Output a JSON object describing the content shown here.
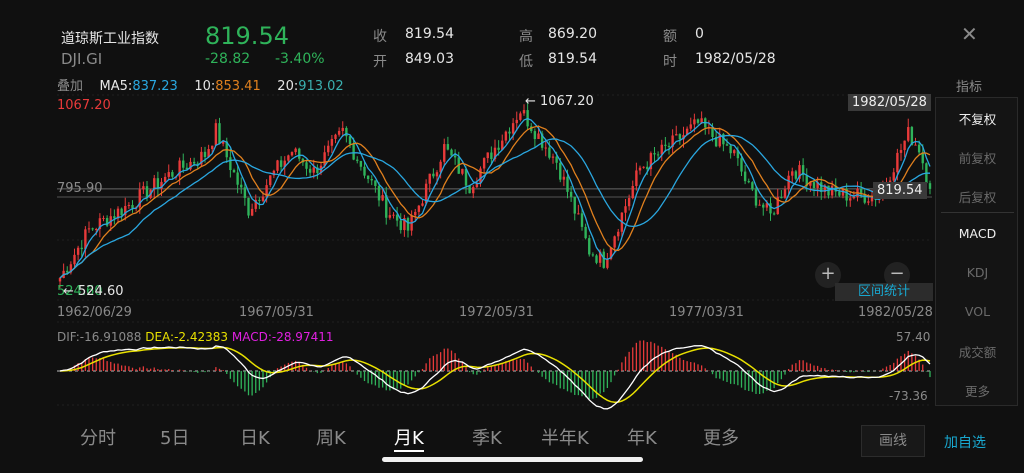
{
  "header": {
    "name": "道琼斯工业指数",
    "code": "DJI.GI",
    "price": "819.54",
    "change": "-28.82",
    "change_pct": "-3.40%",
    "close_label": "收",
    "close": "819.54",
    "open_label": "开",
    "open": "849.03",
    "high_label": "高",
    "high": "869.20",
    "low_label": "低",
    "low": "819.54",
    "amount_label": "额",
    "amount": "0",
    "time_label": "时",
    "time": "1982/05/28"
  },
  "overlay": {
    "label": "叠加",
    "ma5_label": "MA5:",
    "ma5": "837.23",
    "ma10_label": "10:",
    "ma10": "853.41",
    "ma20_label": "20:",
    "ma20": "913.02"
  },
  "colors": {
    "up": "#e83a3a",
    "down": "#2fb35a",
    "ma5": "#2aa7e0",
    "ma10": "#e0801e",
    "ma20": "#2aa7e0",
    "dif": "#ffffff",
    "dea": "#e8e000",
    "macd": "#e020e0"
  },
  "chart": {
    "max_label": "1067.20",
    "max_marker": "1067.20",
    "mid_label": "795.90",
    "min_label": "524.60",
    "min_marker": "524.60",
    "cursor_date": "1982/05/28",
    "cursor_price": "819.54",
    "dates": [
      "1962/06/29",
      "1967/05/31",
      "1972/05/31",
      "1977/03/31",
      "1982/05/28"
    ],
    "zoom_in": "+",
    "zoom_out": "−",
    "range_stats": "区间统计"
  },
  "macd": {
    "dif": "DIF:-16.91088",
    "dea": "DEA:-2.42383",
    "macd": "MACD:-28.97411",
    "max": "57.40",
    "min": "-73.36"
  },
  "chart_data": {
    "type": "candlestick",
    "x_start": "1962/06",
    "x_end": "1982/05",
    "ylim": [
      524.6,
      1067.2
    ],
    "anchors": [
      [
        0,
        560
      ],
      [
        8,
        700
      ],
      [
        20,
        780
      ],
      [
        30,
        860
      ],
      [
        40,
        920
      ],
      [
        43,
        990
      ],
      [
        52,
        760
      ],
      [
        60,
        880
      ],
      [
        64,
        930
      ],
      [
        70,
        870
      ],
      [
        78,
        985
      ],
      [
        90,
        760
      ],
      [
        96,
        700
      ],
      [
        106,
        940
      ],
      [
        113,
        830
      ],
      [
        127,
        1050
      ],
      [
        137,
        900
      ],
      [
        146,
        640
      ],
      [
        150,
        610
      ],
      [
        160,
        880
      ],
      [
        170,
        960
      ],
      [
        176,
        1010
      ],
      [
        186,
        920
      ],
      [
        190,
        820
      ],
      [
        196,
        740
      ],
      [
        202,
        880
      ],
      [
        212,
        810
      ],
      [
        218,
        800
      ],
      [
        226,
        800
      ],
      [
        234,
        980
      ],
      [
        237,
        940
      ],
      [
        240,
        819.54
      ]
    ]
  },
  "side": {
    "title": "指标",
    "items": [
      "不复权",
      "前复权",
      "后复权",
      "MACD",
      "KDJ",
      "VOL",
      "成交额",
      "更多"
    ]
  },
  "tabs": [
    "分时",
    "5日",
    "日K",
    "周K",
    "月K",
    "季K",
    "半年K",
    "年K",
    "更多"
  ],
  "buttons": {
    "draw": "画线",
    "add": "加自选",
    "close": "✕"
  }
}
